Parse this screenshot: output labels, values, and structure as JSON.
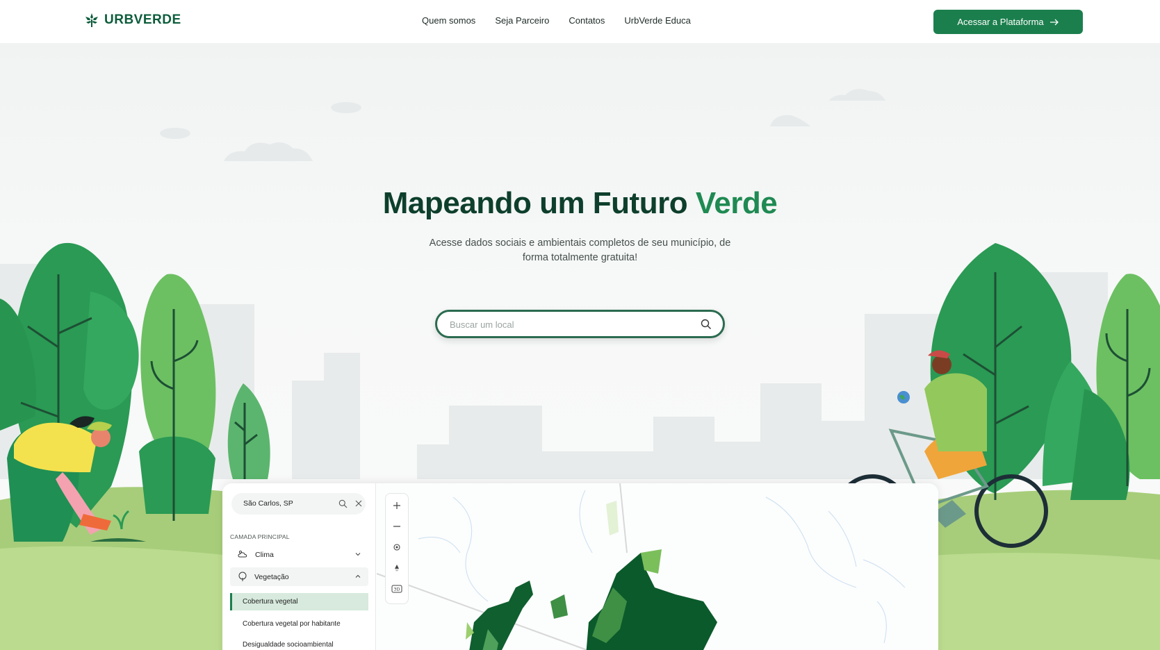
{
  "header": {
    "logo_text": "URBVERDE",
    "nav": [
      "Quem somos",
      "Seja Parceiro",
      "Contatos",
      "UrbVerde Educa"
    ],
    "cta_label": "Acessar a Plataforma"
  },
  "hero": {
    "title_main": "Mapeando um Futuro",
    "title_accent": "Verde",
    "subtitle": "Acesse dados sociais e ambientais completos de seu município, de forma totalmente gratuita!",
    "search_placeholder": "Buscar um local"
  },
  "mockup": {
    "search_value": "São Carlos, SP",
    "section_label": "CAMADA PRINCIPAL",
    "categories": [
      {
        "label": "Clima",
        "icon": "cloud-sun-icon",
        "expanded": false
      },
      {
        "label": "Vegetação",
        "icon": "tree-icon",
        "expanded": true
      }
    ],
    "layers": [
      "Cobertura vegetal",
      "Cobertura vegetal por habitante",
      "Desigualdade socioambiental"
    ],
    "active_layer": "Cobertura vegetal",
    "map_tools": [
      "zoom-in-icon",
      "zoom-out-icon",
      "locate-icon",
      "compass-icon",
      "3d-icon"
    ],
    "tool_3d_label": "3D"
  },
  "colors": {
    "brand_dark": "#0d3f2c",
    "brand_green": "#1f8a52",
    "cta_bg": "#1b7f4d",
    "active_layer_bg": "#d7eadd"
  }
}
